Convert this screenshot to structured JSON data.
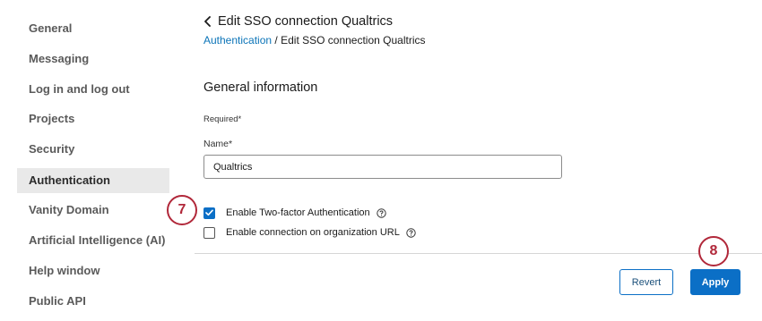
{
  "sidebar": {
    "items": [
      {
        "label": "General",
        "active": false
      },
      {
        "label": "Messaging",
        "active": false
      },
      {
        "label": "Log in and log out",
        "active": false
      },
      {
        "label": "Projects",
        "active": false
      },
      {
        "label": "Security",
        "active": false
      },
      {
        "label": "Authentication",
        "active": true
      },
      {
        "label": "Vanity Domain",
        "active": false
      },
      {
        "label": "Artificial Intelligence (AI)",
        "active": false
      },
      {
        "label": "Help window",
        "active": false
      },
      {
        "label": "Public API",
        "active": false
      }
    ]
  },
  "header": {
    "back_icon": "chevron-left-icon",
    "title": "Edit SSO connection Qualtrics"
  },
  "breadcrumb": {
    "parent": "Authentication",
    "separator": "/",
    "current": "Edit SSO connection Qualtrics"
  },
  "form": {
    "section_title": "General information",
    "required_note": "Required*",
    "name_label": "Name*",
    "name_value": "Qualtrics",
    "two_factor": {
      "label": "Enable Two-factor Authentication",
      "checked": true,
      "help_icon": "question-circle-icon"
    },
    "org_url": {
      "label": "Enable connection on organization URL",
      "checked": false,
      "help_icon": "question-circle-icon"
    }
  },
  "actions": {
    "revert_label": "Revert",
    "apply_label": "Apply"
  },
  "callouts": {
    "step_7": "7",
    "step_8": "8"
  },
  "colors": {
    "accent": "#0b6fc6",
    "link": "#0b74b8",
    "callout": "#b1283a",
    "sidebar_active_bg": "#e9e9e9"
  }
}
